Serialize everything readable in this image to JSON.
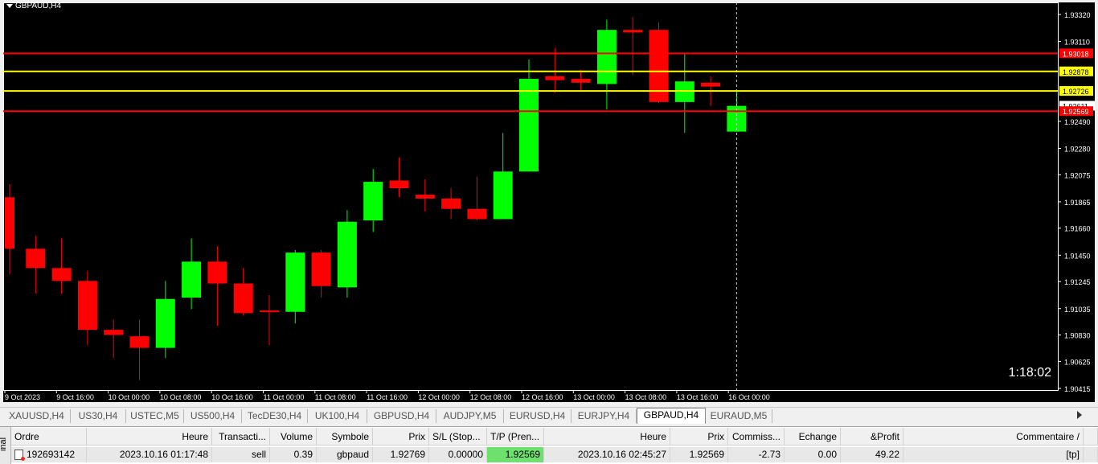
{
  "chart": {
    "symbol_label": "GBPAUD,H4",
    "timer": "1:18:02",
    "colors": {
      "background": "#000000",
      "bull": "#00ff00",
      "bear": "#ff0000",
      "frame": "#ffffff",
      "axis_bg": "#000000",
      "hline_red": "#ff0000",
      "hline_yellow": "#ffff00"
    },
    "price_axis": {
      "min": 1.90415,
      "max": 1.9332,
      "ticks": [
        "1.93320",
        "1.93110",
        "1.92490",
        "1.92280",
        "1.92075",
        "1.91865",
        "1.91660",
        "1.91450",
        "1.91245",
        "1.91035",
        "1.90830",
        "1.90625",
        "1.90415"
      ]
    },
    "time_axis": {
      "ticks": [
        "9 Oct 2023",
        "9 Oct 16:00",
        "10 Oct 00:00",
        "10 Oct 08:00",
        "10 Oct 16:00",
        "11 Oct 00:00",
        "11 Oct 08:00",
        "11 Oct 16:00",
        "12 Oct 00:00",
        "12 Oct 08:00",
        "12 Oct 16:00",
        "13 Oct 00:00",
        "13 Oct 08:00",
        "13 Oct 16:00",
        "16 Oct 00:00"
      ]
    },
    "price_lines": [
      {
        "price": 1.93018,
        "label": "1.93018",
        "color": "#ff0000",
        "label_bg": "#ff0000",
        "label_fg": "#ffffff"
      },
      {
        "price": 1.92878,
        "label": "1.92878",
        "color": "#ffff00",
        "label_bg": "#ffff00",
        "label_fg": "#000000"
      },
      {
        "price": 1.92726,
        "label": "1.92726",
        "color": "#ffff00",
        "label_bg": "#ffff00",
        "label_fg": "#000000"
      },
      {
        "price": 1.92569,
        "label": "1.92569",
        "color": "#ff0000",
        "label_bg": "#ff0000",
        "label_fg": "#ffffff"
      }
    ],
    "current_price_label": "1.92611",
    "candles": [
      {
        "o": 1.919,
        "h": 1.92,
        "l": 1.913,
        "c": 1.915
      },
      {
        "o": 1.915,
        "h": 1.916,
        "l": 1.9115,
        "c": 1.9135
      },
      {
        "o": 1.9135,
        "h": 1.9158,
        "l": 1.9115,
        "c": 1.9125
      },
      {
        "o": 1.9125,
        "h": 1.9133,
        "l": 1.9075,
        "c": 1.9087
      },
      {
        "o": 1.9087,
        "h": 1.9095,
        "l": 1.9065,
        "c": 1.9083
      },
      {
        "o": 1.9082,
        "h": 1.9095,
        "l": 1.9048,
        "c": 1.9073
      },
      {
        "o": 1.9073,
        "h": 1.9125,
        "l": 1.9065,
        "c": 1.9111
      },
      {
        "o": 1.9112,
        "h": 1.9158,
        "l": 1.9103,
        "c": 1.914
      },
      {
        "o": 1.914,
        "h": 1.9152,
        "l": 1.909,
        "c": 1.9123
      },
      {
        "o": 1.9123,
        "h": 1.9135,
        "l": 1.9098,
        "c": 1.91
      },
      {
        "o": 1.9102,
        "h": 1.9114,
        "l": 1.9075,
        "c": 1.9101
      },
      {
        "o": 1.9101,
        "h": 1.9149,
        "l": 1.9092,
        "c": 1.9147
      },
      {
        "o": 1.9147,
        "h": 1.9149,
        "l": 1.9112,
        "c": 1.9121
      },
      {
        "o": 1.912,
        "h": 1.918,
        "l": 1.9112,
        "c": 1.9171
      },
      {
        "o": 1.9172,
        "h": 1.9212,
        "l": 1.9163,
        "c": 1.9202
      },
      {
        "o": 1.9203,
        "h": 1.9221,
        "l": 1.919,
        "c": 1.9197
      },
      {
        "o": 1.9192,
        "h": 1.9204,
        "l": 1.9179,
        "c": 1.9189
      },
      {
        "o": 1.9189,
        "h": 1.9197,
        "l": 1.9173,
        "c": 1.9181
      },
      {
        "o": 1.9181,
        "h": 1.9206,
        "l": 1.9172,
        "c": 1.9173
      },
      {
        "o": 1.9173,
        "h": 1.924,
        "l": 1.9173,
        "c": 1.921
      },
      {
        "o": 1.921,
        "h": 1.9297,
        "l": 1.921,
        "c": 1.9282
      },
      {
        "o": 1.9284,
        "h": 1.9306,
        "l": 1.9271,
        "c": 1.9281
      },
      {
        "o": 1.9282,
        "h": 1.9289,
        "l": 1.9273,
        "c": 1.9279
      },
      {
        "o": 1.9278,
        "h": 1.9328,
        "l": 1.9258,
        "c": 1.932
      },
      {
        "o": 1.932,
        "h": 1.933,
        "l": 1.9285,
        "c": 1.9318
      },
      {
        "o": 1.932,
        "h": 1.9326,
        "l": 1.9263,
        "c": 1.9264
      },
      {
        "o": 1.9264,
        "h": 1.9302,
        "l": 1.924,
        "c": 1.928
      },
      {
        "o": 1.9279,
        "h": 1.9284,
        "l": 1.9261,
        "c": 1.9276
      },
      {
        "o": 1.9241,
        "h": 1.9273,
        "l": 1.9241,
        "c": 1.9261
      }
    ]
  },
  "tabs": [
    {
      "label": "XAUUSD,H4",
      "active": false
    },
    {
      "label": "US30,H4",
      "active": false
    },
    {
      "label": "USTEC,M5",
      "active": false
    },
    {
      "label": "US500,H4",
      "active": false
    },
    {
      "label": "TecDE30,H4",
      "active": false
    },
    {
      "label": "UK100,H4",
      "active": false
    },
    {
      "label": "GBPUSD,H4",
      "active": false
    },
    {
      "label": "AUDJPY,M5",
      "active": false
    },
    {
      "label": "EURUSD,H4",
      "active": false
    },
    {
      "label": "EURJPY,H4",
      "active": false
    },
    {
      "label": "GBPAUD,H4",
      "active": true
    },
    {
      "label": "EURAUD,M5",
      "active": false
    }
  ],
  "terminal": {
    "side_label": "inal",
    "headers": [
      "Ordre",
      "Heure",
      "Transacti...",
      "Volume",
      "Symbole",
      "Prix",
      "S/L (Stop...",
      "T/P (Pren...",
      "Heure",
      "Prix",
      "Commiss...",
      "Echange",
      "&Profit",
      "Commentaire"
    ],
    "sort_indicator": "/",
    "row": [
      "192693142",
      "2023.10.16 01:17:48",
      "sell",
      "0.39",
      "gbpaud",
      "1.92769",
      "0.00000",
      "1.92569",
      "2023.10.16 02:45:27",
      "1.92569",
      "-2.73",
      "0.00",
      "49.22",
      "[tp]"
    ]
  }
}
